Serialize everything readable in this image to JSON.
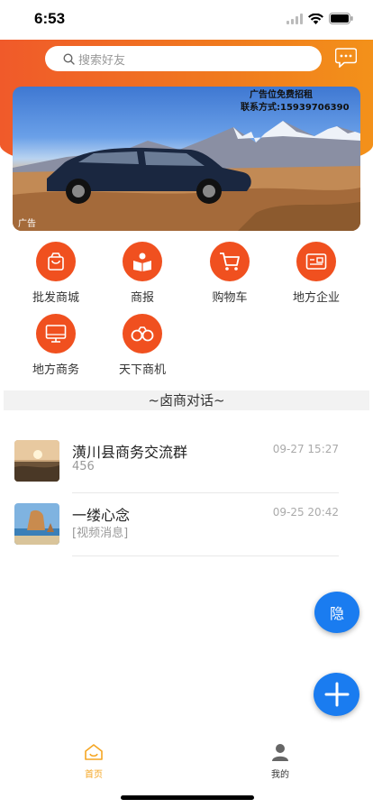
{
  "status_bar": {
    "time": "6:53"
  },
  "search": {
    "placeholder": "搜索好友"
  },
  "banner": {
    "ad_line1": "广告位免费招租",
    "ad_line2": "联系方式:15939706390",
    "tag": "广告"
  },
  "grid": [
    {
      "label": "批发商城",
      "icon": "shopping-bag-icon"
    },
    {
      "label": "商报",
      "icon": "reader-icon"
    },
    {
      "label": "购物车",
      "icon": "cart-icon"
    },
    {
      "label": "地方企业",
      "icon": "card-icon"
    },
    {
      "label": "地方商务",
      "icon": "monitor-icon"
    },
    {
      "label": "天下商机",
      "icon": "binoculars-icon"
    }
  ],
  "section": {
    "title": "~卤商对话~"
  },
  "chats": [
    {
      "name": "潢川县商务交流群",
      "subtitle": "456",
      "time": "09-27 15:27"
    },
    {
      "name": "一缕心念",
      "subtitle": "[视频消息]",
      "time": "09-25 20:42"
    }
  ],
  "floating": {
    "hide_label": "隐"
  },
  "tabbar": {
    "home_label": "首页",
    "mine_label": "我的",
    "active_color": "#f5a623"
  },
  "colors": {
    "accent": "#f0501f",
    "fab": "#1a7cf0"
  }
}
